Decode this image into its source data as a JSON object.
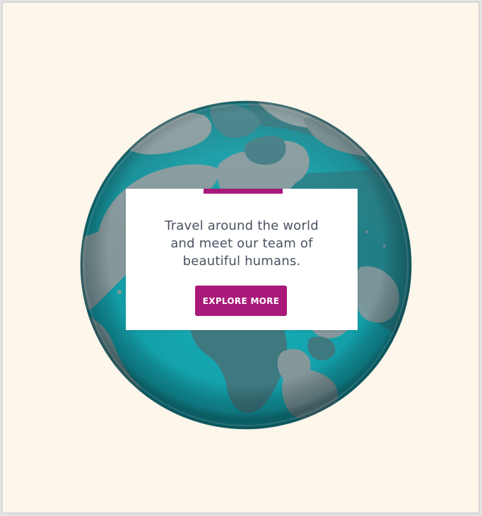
{
  "card": {
    "lines": [
      "Travel around the world",
      "and meet our team of",
      "beautiful humans."
    ],
    "button_label": "EXPLORE MORE"
  },
  "colors": {
    "page_background": "#fdf6ea",
    "ocean": "#14a3ad",
    "land": "#84989b",
    "accent": "#a8197a",
    "text": "#4a5162"
  },
  "icons": {
    "globe": "globe-illustration"
  }
}
